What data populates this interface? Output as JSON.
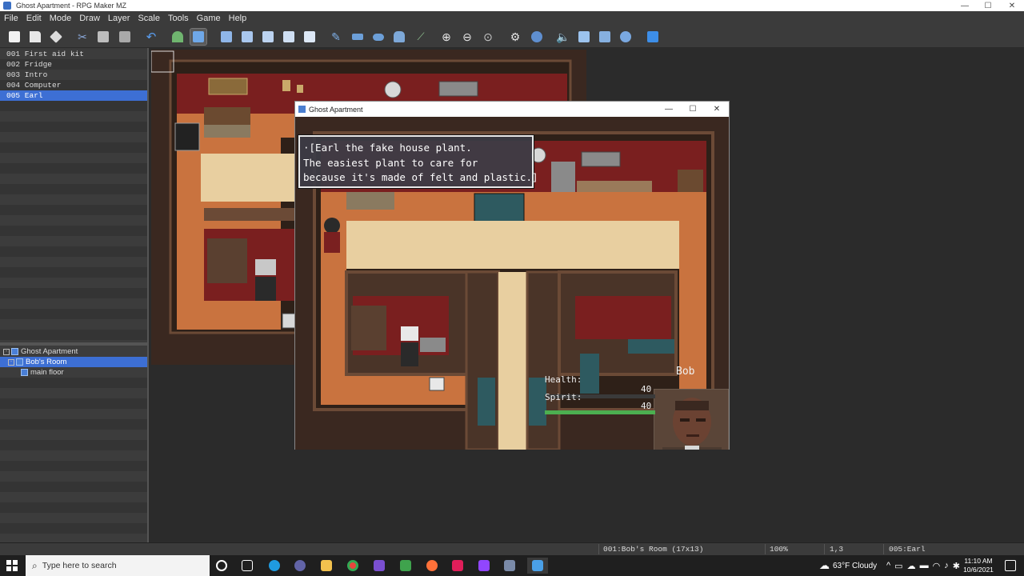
{
  "window": {
    "title": "Ghost Apartment - RPG Maker MZ",
    "controls": [
      "—",
      "☐",
      "✕"
    ]
  },
  "menu": [
    "File",
    "Edit",
    "Mode",
    "Draw",
    "Layer",
    "Scale",
    "Tools",
    "Game",
    "Help"
  ],
  "toolbar": {
    "icons": [
      "new-project-icon",
      "open-project-icon",
      "save-project-icon",
      "cut-icon",
      "copy-icon",
      "paste-icon",
      "undo-icon",
      "map-mode-icon",
      "event-mode-icon",
      "layer-a-icon",
      "layer-b-icon",
      "layer-c-icon",
      "layer-d-icon",
      "layer-r-icon",
      "pencil-icon",
      "rectangle-icon",
      "ellipse-icon",
      "fill-icon",
      "shadow-pen-icon",
      "zoom-in-icon",
      "zoom-out-icon",
      "zoom-actual-icon",
      "database-icon",
      "plugin-manager-icon",
      "sound-test-icon",
      "event-searcher-icon",
      "resource-manager-icon",
      "character-generator-icon",
      "playtest-icon"
    ],
    "active": [
      "map-mode-icon",
      "event-mode-icon"
    ]
  },
  "event_list": [
    "001 First aid kit",
    "002 Fridge",
    "003 Intro",
    "004 Computer",
    "005 Earl"
  ],
  "event_list_selected": 4,
  "map_tree": {
    "project": "Ghost Apartment",
    "map": "Bob's Room",
    "child": "main floor",
    "expand_symbol": "-"
  },
  "game_window": {
    "title": "Ghost Apartment",
    "controls": [
      "—",
      "☐",
      "✕"
    ],
    "message_lines": [
      "·[Earl the fake house plant.",
      "The easiest plant to care for",
      "because it's made of felt and plastic.]"
    ],
    "hud": {
      "name": "Bob",
      "health_label": "Health:",
      "spirit_label": "Spirit:",
      "health_value": "40",
      "spirit_value": "40",
      "health_fill": 0.0,
      "spirit_fill": 1.0,
      "spirit_color": "#4caf50"
    }
  },
  "status_bar": {
    "map": "001:Bob's Room (17x13)",
    "zoom": "100%",
    "coords": "1,3",
    "event": "005:Earl"
  },
  "taskbar": {
    "search_placeholder": "Type here to search",
    "weather": "63°F  Cloudy",
    "time": "11:10 AM",
    "date": "10/6/2021",
    "apps": [
      "cortana-icon",
      "task-view-icon",
      "edge-icon",
      "teams-icon",
      "file-explorer-icon",
      "chrome-icon",
      "app-icon",
      "app-icon-2",
      "firefox-icon",
      "slack-icon",
      "twitch-icon",
      "rpgmaker-icon",
      "rpgmaker-active-icon"
    ]
  },
  "colors": {
    "accent": "#3d6fd4",
    "panel": "#3b3b3b",
    "message_bg": "#3c3c46"
  }
}
